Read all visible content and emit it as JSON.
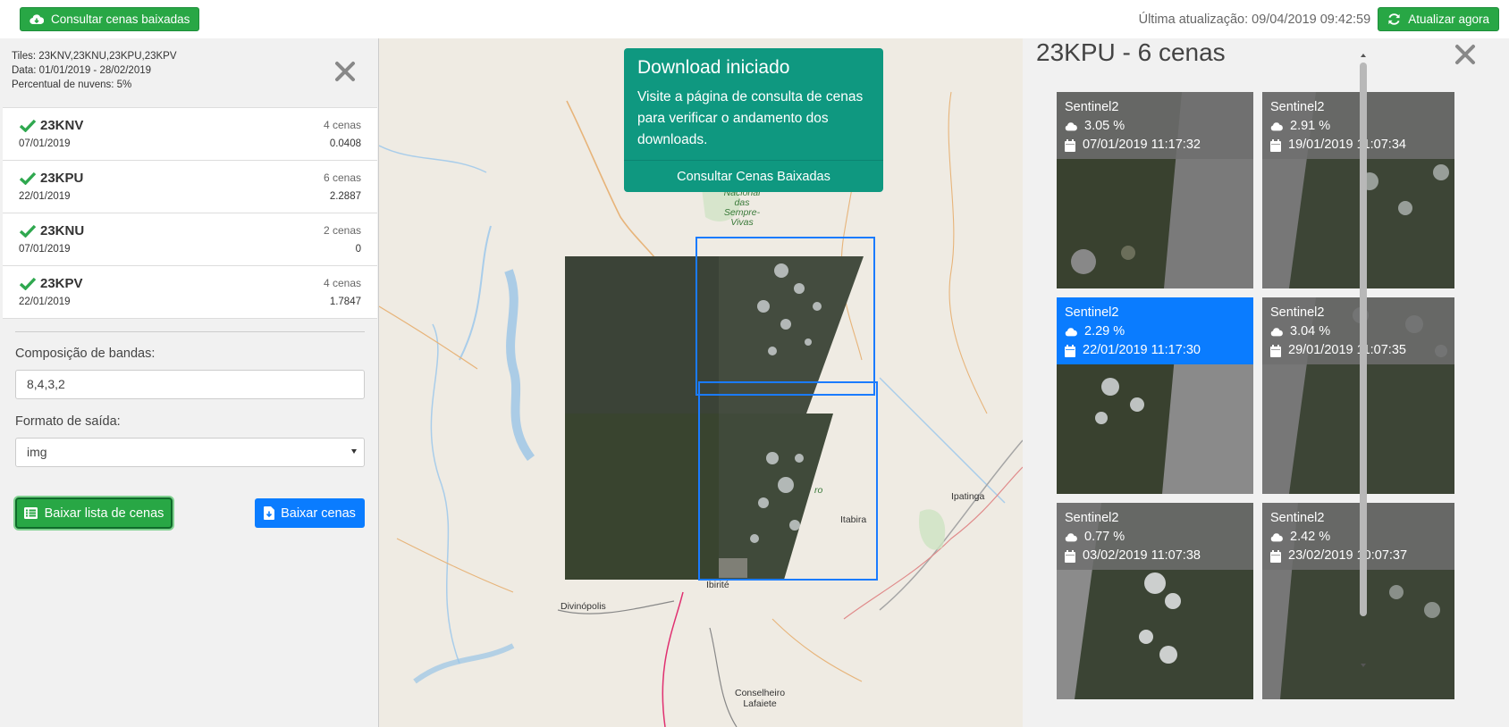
{
  "topbar": {
    "downloaded_button": "Consultar cenas baixadas",
    "last_update": "Última atualização: 09/04/2019 09:42:59",
    "refresh_button": "Atualizar agora"
  },
  "filter": {
    "tiles": "Tiles: 23KNV,23KNU,23KPU,23KPV",
    "date": "Data: 01/01/2019 - 28/02/2019",
    "clouds": "Percentual de nuvens: 5%"
  },
  "tiles": [
    {
      "name": "23KNV",
      "date": "07/01/2019",
      "count": "4 cenas",
      "value": "0.0408"
    },
    {
      "name": "23KPU",
      "date": "22/01/2019",
      "count": "6 cenas",
      "value": "2.2887"
    },
    {
      "name": "23KNU",
      "date": "07/01/2019",
      "count": "2 cenas",
      "value": "0"
    },
    {
      "name": "23KPV",
      "date": "22/01/2019",
      "count": "4 cenas",
      "value": "1.7847"
    }
  ],
  "form": {
    "bands_label": "Composição de bandas:",
    "bands_value": "8,4,3,2",
    "format_label": "Formato de saída:",
    "format_value": "img",
    "list_button": "Baixar lista de cenas",
    "download_button": "Baixar cenas"
  },
  "toast": {
    "title": "Download iniciado",
    "body": "Visite a página de consulta de cenas para verificar o andamento dos downloads.",
    "action": "Consultar Cenas Baixadas"
  },
  "map_labels": {
    "park": "Parque Nacional das Sempre-Vivas",
    "park_l1": "Nacional",
    "park_l2": "das Sempre-",
    "park_l3": "Vivas",
    "ipatinga": "Ipatinga",
    "itabira": "Itabira",
    "ibirite": "Ibirité",
    "divinopolis": "Divinópolis",
    "conselheiro1": "Conselheiro",
    "conselheiro2": "Lafaiete",
    "ro": "ro"
  },
  "scenes_panel": {
    "title": "23KPU - 6 cenas",
    "scenes": [
      {
        "sat": "Sentinel2",
        "cloud": "3.05 %",
        "datetime": "07/01/2019 11:17:32",
        "selected": false
      },
      {
        "sat": "Sentinel2",
        "cloud": "2.91 %",
        "datetime": "19/01/2019 11:07:34",
        "selected": false
      },
      {
        "sat": "Sentinel2",
        "cloud": "2.29 %",
        "datetime": "22/01/2019 11:17:30",
        "selected": true
      },
      {
        "sat": "Sentinel2",
        "cloud": "3.04 %",
        "datetime": "29/01/2019 11:07:35",
        "selected": false
      },
      {
        "sat": "Sentinel2",
        "cloud": "0.77 %",
        "datetime": "03/02/2019 11:07:38",
        "selected": false
      },
      {
        "sat": "Sentinel2",
        "cloud": "2.42 %",
        "datetime": "23/02/2019 10:07:37",
        "selected": false
      }
    ]
  },
  "colors": {
    "green": "#28a745",
    "blue": "#0a7cff",
    "teal": "#0f9880",
    "selected_outline": "#1a7bff"
  }
}
